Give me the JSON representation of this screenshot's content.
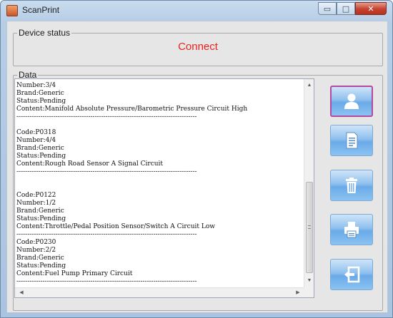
{
  "window": {
    "title": "ScanPrint",
    "minimize_glyph": "▭",
    "maximize_glyph": "□",
    "close_glyph": "✕"
  },
  "device_status": {
    "label": "Device status",
    "status_text": "Connect",
    "status_color": "#e8241c"
  },
  "data_panel": {
    "label": "Data",
    "text": "Number:3/4\nBrand:Generic\nStatus:Pending\nContent:Manifold Absolute Pressure/Barometric Pressure Circuit High\n-----------------------------------------------------------------------------------\n\nCode:P0318\nNumber:4/4\nBrand:Generic\nStatus:Pending\nContent:Rough Road Sensor A Signal Circuit\n-----------------------------------------------------------------------------------\n\n\nCode:P0122\nNumber:1/2\nBrand:Generic\nStatus:Pending\nContent:Throttle/Pedal Position Sensor/Switch A Circuit Low\n-----------------------------------------------------------------------------------\nCode:P0230\nNumber:2/2\nBrand:Generic\nStatus:Pending\nContent:Fuel Pump Primary Circuit\n-----------------------------------------------------------------------------------"
  },
  "action_buttons": [
    {
      "icon": "user-icon"
    },
    {
      "icon": "document-icon"
    },
    {
      "icon": "trash-icon"
    },
    {
      "icon": "printer-icon"
    },
    {
      "icon": "exit-icon"
    }
  ],
  "colors": {
    "button_blue": "#6aaae8",
    "active_border": "#b14aa0"
  }
}
